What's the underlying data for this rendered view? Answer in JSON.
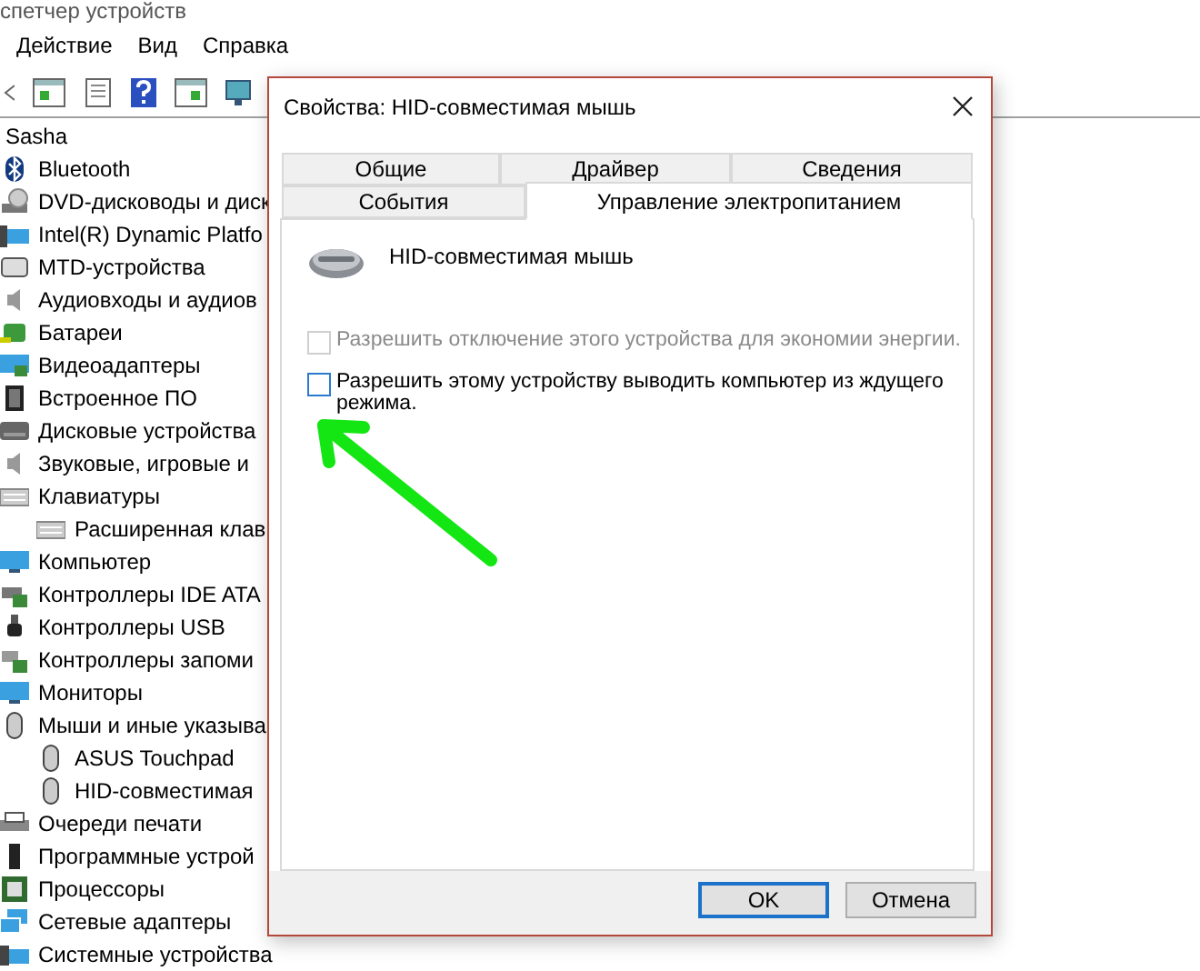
{
  "app": {
    "title": "спетчер устройств",
    "menu": [
      "Действие",
      "Вид",
      "Справка"
    ]
  },
  "tree": {
    "label": "Sasha",
    "children": [
      {
        "label": "Bluetooth"
      },
      {
        "label": "DVD-дисководы и диск"
      },
      {
        "label": "Intel(R) Dynamic Platfo"
      },
      {
        "label": "MTD-устройства"
      },
      {
        "label": "Аудиовходы и аудиов"
      },
      {
        "label": "Батареи"
      },
      {
        "label": "Видеоадаптеры"
      },
      {
        "label": "Встроенное ПО"
      },
      {
        "label": "Дисковые устройства"
      },
      {
        "label": "Звуковые, игровые и"
      },
      {
        "label": "Клавиатуры",
        "children": [
          {
            "label": "Расширенная клав"
          }
        ]
      },
      {
        "label": "Компьютер"
      },
      {
        "label": "Контроллеры IDE ATA"
      },
      {
        "label": "Контроллеры USB"
      },
      {
        "label": "Контроллеры запоми"
      },
      {
        "label": "Мониторы"
      },
      {
        "label": "Мыши и иные указыва",
        "children": [
          {
            "label": "ASUS Touchpad"
          },
          {
            "label": "HID-совместимая"
          }
        ]
      },
      {
        "label": "Очереди печати"
      },
      {
        "label": "Программные устрой"
      },
      {
        "label": "Процессоры"
      },
      {
        "label": "Сетевые адаптеры"
      },
      {
        "label": "Системные устройства"
      }
    ]
  },
  "dialog": {
    "title": "Свойства: HID-совместимая мышь",
    "tab_rows": [
      [
        {
          "label": "Общие",
          "selected": false
        },
        {
          "label": "Драйвер",
          "selected": false
        },
        {
          "label": "Сведения",
          "selected": false
        }
      ],
      [
        {
          "label": "События",
          "selected": false
        },
        {
          "label": "Управление электропитанием",
          "selected": true
        }
      ]
    ],
    "device_name": "HID-совместимая мышь",
    "checkboxes": [
      {
        "label": "Разрешить отключение этого устройства для экономии энергии.",
        "checked": false,
        "disabled": true
      },
      {
        "label": "Разрешить этому устройству выводить компьютер из ждущего режима.",
        "checked": false,
        "disabled": false
      }
    ],
    "buttons": [
      {
        "label": "OK",
        "default": true
      },
      {
        "label": "Отмена",
        "default": false
      }
    ]
  }
}
